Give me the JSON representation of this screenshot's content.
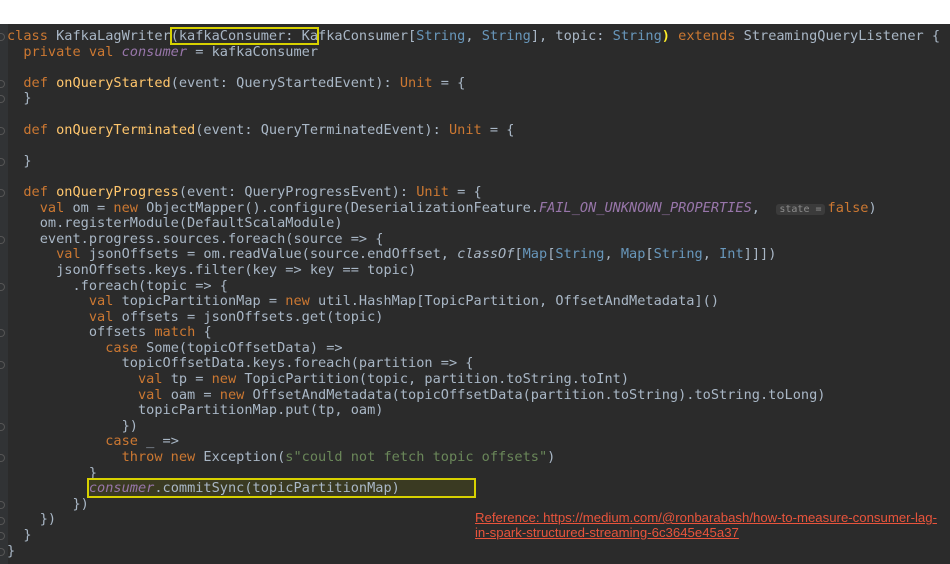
{
  "editor": {
    "theme_colors": {
      "background": "#2b2b2b",
      "keyword": "#cc7832",
      "function": "#ffc66d",
      "text": "#a9b7c6",
      "type_param": "#6897bb",
      "field": "#9876aa",
      "string": "#6a8759",
      "highlight_box": "#d7d100"
    },
    "lines": [
      [
        {
          "t": "class ",
          "c": "kw"
        },
        {
          "t": "KafkaLagWriter",
          "c": ""
        },
        {
          "t": "(kafkaConsumer: Ka",
          "c": "boxed"
        },
        {
          "t": "fkaConsumer[",
          "c": ""
        },
        {
          "t": "String",
          "c": "tp"
        },
        {
          "t": ", ",
          "c": ""
        },
        {
          "t": "String",
          "c": "tp"
        },
        {
          "t": "], topic: ",
          "c": ""
        },
        {
          "t": "String",
          "c": "tp"
        },
        {
          "t": ")",
          "c": "match"
        },
        {
          "t": " extends ",
          "c": "kw"
        },
        {
          "t": "StreamingQueryListener {",
          "c": ""
        }
      ],
      [
        {
          "t": "  private val ",
          "c": "kw"
        },
        {
          "t": "consumer",
          "c": "fld"
        },
        {
          "t": " = kafkaConsumer",
          "c": ""
        }
      ],
      [],
      [
        {
          "t": "  def ",
          "c": "kw"
        },
        {
          "t": "onQueryStarted",
          "c": "fn"
        },
        {
          "t": "(event: QueryStartedEvent): ",
          "c": ""
        },
        {
          "t": "Unit",
          "c": "kw"
        },
        {
          "t": " = {",
          "c": ""
        }
      ],
      [
        {
          "t": "  }",
          "c": ""
        }
      ],
      [],
      [
        {
          "t": "  def ",
          "c": "kw"
        },
        {
          "t": "onQueryTerminated",
          "c": "fn"
        },
        {
          "t": "(event: QueryTerminatedEvent): ",
          "c": ""
        },
        {
          "t": "Unit",
          "c": "kw"
        },
        {
          "t": " = {",
          "c": ""
        }
      ],
      [],
      [
        {
          "t": "  }",
          "c": ""
        }
      ],
      [],
      [
        {
          "t": "  def ",
          "c": "kw"
        },
        {
          "t": "onQueryProgress",
          "c": "fn"
        },
        {
          "t": "(event: QueryProgressEvent): ",
          "c": ""
        },
        {
          "t": "Unit",
          "c": "kw"
        },
        {
          "t": " = {",
          "c": ""
        }
      ],
      [
        {
          "t": "    val ",
          "c": "kw"
        },
        {
          "t": "om = ",
          "c": ""
        },
        {
          "t": "new ",
          "c": "kw"
        },
        {
          "t": "ObjectMapper().configure(DeserializationFeature.",
          "c": ""
        },
        {
          "t": "FAIL_ON_UNKNOWN_PROPERTIES",
          "c": "const"
        },
        {
          "t": ",  ",
          "c": ""
        },
        {
          "t": "state =",
          "c": "hint"
        },
        {
          "t": "false",
          "c": "kw"
        },
        {
          "t": ")",
          "c": ""
        }
      ],
      [
        {
          "t": "    om.registerModule(DefaultScalaModule)",
          "c": ""
        }
      ],
      [
        {
          "t": "    event.progress.sources.foreach(source => {",
          "c": ""
        }
      ],
      [
        {
          "t": "      val ",
          "c": "kw"
        },
        {
          "t": "jsonOffsets = om.readValue(source.endOffset, ",
          "c": ""
        },
        {
          "t": "classOf",
          "c": "it"
        },
        {
          "t": "[",
          "c": ""
        },
        {
          "t": "Map",
          "c": "tp"
        },
        {
          "t": "[",
          "c": ""
        },
        {
          "t": "String",
          "c": "tp"
        },
        {
          "t": ", ",
          "c": ""
        },
        {
          "t": "Map",
          "c": "tp"
        },
        {
          "t": "[",
          "c": ""
        },
        {
          "t": "String",
          "c": "tp"
        },
        {
          "t": ", ",
          "c": ""
        },
        {
          "t": "Int",
          "c": "tp"
        },
        {
          "t": "]]])",
          "c": ""
        }
      ],
      [
        {
          "t": "      jsonOffsets.keys.filter(key => key == topic)",
          "c": ""
        }
      ],
      [
        {
          "t": "        .foreach(topic => {",
          "c": ""
        }
      ],
      [
        {
          "t": "          val ",
          "c": "kw"
        },
        {
          "t": "topicPartitionMap = ",
          "c": ""
        },
        {
          "t": "new ",
          "c": "kw"
        },
        {
          "t": "util.HashMap[TopicPartition, OffsetAndMetadata]()",
          "c": ""
        }
      ],
      [
        {
          "t": "          val ",
          "c": "kw"
        },
        {
          "t": "offsets = jsonOffsets.get(topic)",
          "c": ""
        }
      ],
      [
        {
          "t": "          offsets ",
          "c": ""
        },
        {
          "t": "match ",
          "c": "kw"
        },
        {
          "t": "{",
          "c": ""
        }
      ],
      [
        {
          "t": "            case ",
          "c": "kw"
        },
        {
          "t": "Some(topicOffsetData) =>",
          "c": ""
        }
      ],
      [
        {
          "t": "              topicOffsetData.keys.foreach(partition => {",
          "c": ""
        }
      ],
      [
        {
          "t": "                val ",
          "c": "kw"
        },
        {
          "t": "tp = ",
          "c": ""
        },
        {
          "t": "new ",
          "c": "kw"
        },
        {
          "t": "TopicPartition(topic, partition.toString.toInt)",
          "c": ""
        }
      ],
      [
        {
          "t": "                val ",
          "c": "kw"
        },
        {
          "t": "oam = ",
          "c": ""
        },
        {
          "t": "new ",
          "c": "kw"
        },
        {
          "t": "OffsetAndMetadata(topicOffsetData(partition.toString).toString.toLong)",
          "c": ""
        }
      ],
      [
        {
          "t": "                topicPartitionMap.put(tp, oam)",
          "c": ""
        }
      ],
      [
        {
          "t": "              })",
          "c": ""
        }
      ],
      [
        {
          "t": "            case ",
          "c": "kw"
        },
        {
          "t": "_ =>",
          "c": ""
        }
      ],
      [
        {
          "t": "              throw new ",
          "c": "kw"
        },
        {
          "t": "Exception(",
          "c": ""
        },
        {
          "t": "s\"could not fetch topic offsets\"",
          "c": "str"
        },
        {
          "t": ")",
          "c": ""
        }
      ],
      [
        {
          "t": "          }",
          "c": ""
        }
      ],
      [
        {
          "t": "          ",
          "c": ""
        },
        {
          "t": "consumer",
          "c": "fld"
        },
        {
          "t": ".commitSync(topicPartitionMap)",
          "c": ""
        },
        {
          "t": "         ",
          "c": ""
        }
      ],
      [
        {
          "t": "        })",
          "c": ""
        }
      ],
      [
        {
          "t": "    })",
          "c": ""
        }
      ],
      [
        {
          "t": "  }",
          "c": ""
        }
      ],
      [
        {
          "t": "}",
          "c": ""
        }
      ]
    ],
    "highlighted_line_index": 29
  },
  "reference": {
    "text": "Reference: https://medium.com/@ronbarabash/how-to-measure-consumer-lag-in-spark-structured-streaming-6c3645e45a37"
  }
}
